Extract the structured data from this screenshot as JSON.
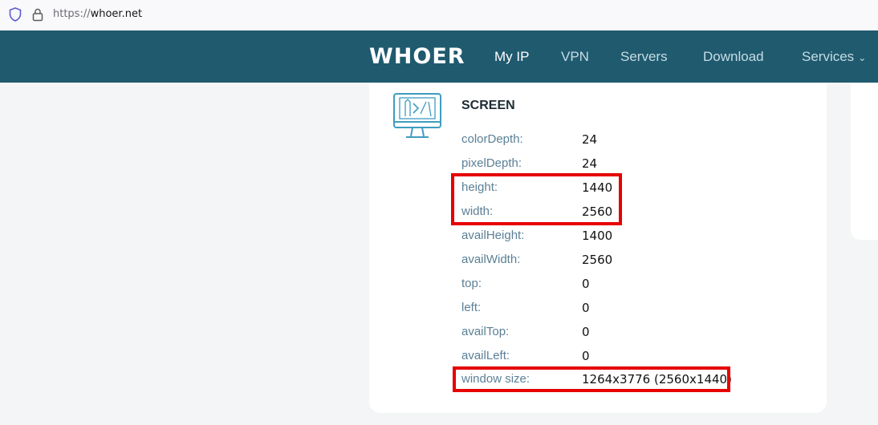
{
  "browser": {
    "url_scheme": "https://",
    "url_host": "whoer.net"
  },
  "nav": {
    "logo": "WHOER",
    "items": [
      "My IP",
      "VPN",
      "Servers",
      "Download",
      "Services"
    ]
  },
  "screen": {
    "title": "SCREEN",
    "rows": [
      {
        "key": "colorDepth:",
        "value": "24"
      },
      {
        "key": "pixelDepth:",
        "value": "24"
      },
      {
        "key": "height:",
        "value": "1440"
      },
      {
        "key": "width:",
        "value": "2560"
      },
      {
        "key": "availHeight:",
        "value": "1400"
      },
      {
        "key": "availWidth:",
        "value": "2560"
      },
      {
        "key": "top:",
        "value": "0"
      },
      {
        "key": "left:",
        "value": "0"
      },
      {
        "key": "availTop:",
        "value": "0"
      },
      {
        "key": "availLeft:",
        "value": "0"
      },
      {
        "key": "window size:",
        "value": "1264x3776 (2560x1440)"
      }
    ]
  },
  "colors": {
    "nav_bg": "#205a6f",
    "highlight": "#e60000",
    "key_text": "#5b8096"
  }
}
